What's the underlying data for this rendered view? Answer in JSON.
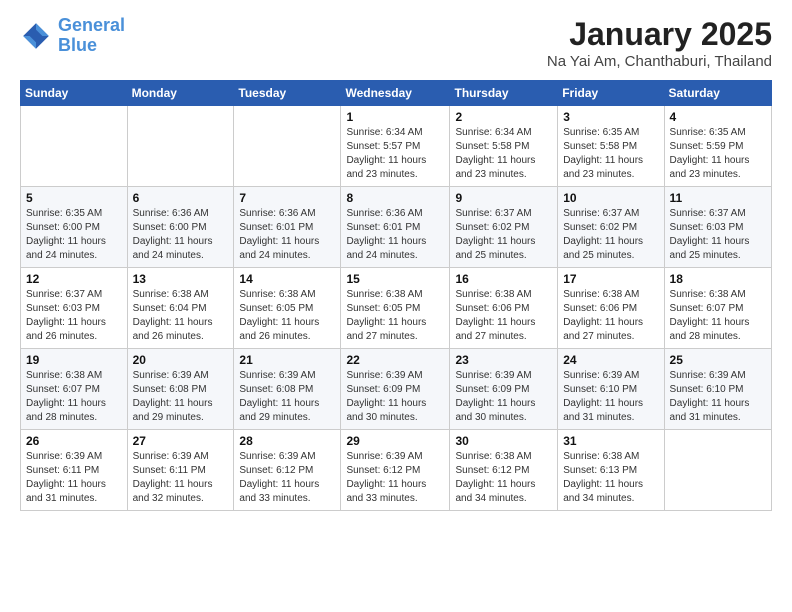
{
  "logo": {
    "line1": "General",
    "line2": "Blue"
  },
  "title": "January 2025",
  "subtitle": "Na Yai Am, Chanthaburi, Thailand",
  "days_of_week": [
    "Sunday",
    "Monday",
    "Tuesday",
    "Wednesday",
    "Thursday",
    "Friday",
    "Saturday"
  ],
  "weeks": [
    [
      {
        "day": "",
        "info": ""
      },
      {
        "day": "",
        "info": ""
      },
      {
        "day": "",
        "info": ""
      },
      {
        "day": "1",
        "info": "Sunrise: 6:34 AM\nSunset: 5:57 PM\nDaylight: 11 hours\nand 23 minutes."
      },
      {
        "day": "2",
        "info": "Sunrise: 6:34 AM\nSunset: 5:58 PM\nDaylight: 11 hours\nand 23 minutes."
      },
      {
        "day": "3",
        "info": "Sunrise: 6:35 AM\nSunset: 5:58 PM\nDaylight: 11 hours\nand 23 minutes."
      },
      {
        "day": "4",
        "info": "Sunrise: 6:35 AM\nSunset: 5:59 PM\nDaylight: 11 hours\nand 23 minutes."
      }
    ],
    [
      {
        "day": "5",
        "info": "Sunrise: 6:35 AM\nSunset: 6:00 PM\nDaylight: 11 hours\nand 24 minutes."
      },
      {
        "day": "6",
        "info": "Sunrise: 6:36 AM\nSunset: 6:00 PM\nDaylight: 11 hours\nand 24 minutes."
      },
      {
        "day": "7",
        "info": "Sunrise: 6:36 AM\nSunset: 6:01 PM\nDaylight: 11 hours\nand 24 minutes."
      },
      {
        "day": "8",
        "info": "Sunrise: 6:36 AM\nSunset: 6:01 PM\nDaylight: 11 hours\nand 24 minutes."
      },
      {
        "day": "9",
        "info": "Sunrise: 6:37 AM\nSunset: 6:02 PM\nDaylight: 11 hours\nand 25 minutes."
      },
      {
        "day": "10",
        "info": "Sunrise: 6:37 AM\nSunset: 6:02 PM\nDaylight: 11 hours\nand 25 minutes."
      },
      {
        "day": "11",
        "info": "Sunrise: 6:37 AM\nSunset: 6:03 PM\nDaylight: 11 hours\nand 25 minutes."
      }
    ],
    [
      {
        "day": "12",
        "info": "Sunrise: 6:37 AM\nSunset: 6:03 PM\nDaylight: 11 hours\nand 26 minutes."
      },
      {
        "day": "13",
        "info": "Sunrise: 6:38 AM\nSunset: 6:04 PM\nDaylight: 11 hours\nand 26 minutes."
      },
      {
        "day": "14",
        "info": "Sunrise: 6:38 AM\nSunset: 6:05 PM\nDaylight: 11 hours\nand 26 minutes."
      },
      {
        "day": "15",
        "info": "Sunrise: 6:38 AM\nSunset: 6:05 PM\nDaylight: 11 hours\nand 27 minutes."
      },
      {
        "day": "16",
        "info": "Sunrise: 6:38 AM\nSunset: 6:06 PM\nDaylight: 11 hours\nand 27 minutes."
      },
      {
        "day": "17",
        "info": "Sunrise: 6:38 AM\nSunset: 6:06 PM\nDaylight: 11 hours\nand 27 minutes."
      },
      {
        "day": "18",
        "info": "Sunrise: 6:38 AM\nSunset: 6:07 PM\nDaylight: 11 hours\nand 28 minutes."
      }
    ],
    [
      {
        "day": "19",
        "info": "Sunrise: 6:38 AM\nSunset: 6:07 PM\nDaylight: 11 hours\nand 28 minutes."
      },
      {
        "day": "20",
        "info": "Sunrise: 6:39 AM\nSunset: 6:08 PM\nDaylight: 11 hours\nand 29 minutes."
      },
      {
        "day": "21",
        "info": "Sunrise: 6:39 AM\nSunset: 6:08 PM\nDaylight: 11 hours\nand 29 minutes."
      },
      {
        "day": "22",
        "info": "Sunrise: 6:39 AM\nSunset: 6:09 PM\nDaylight: 11 hours\nand 30 minutes."
      },
      {
        "day": "23",
        "info": "Sunrise: 6:39 AM\nSunset: 6:09 PM\nDaylight: 11 hours\nand 30 minutes."
      },
      {
        "day": "24",
        "info": "Sunrise: 6:39 AM\nSunset: 6:10 PM\nDaylight: 11 hours\nand 31 minutes."
      },
      {
        "day": "25",
        "info": "Sunrise: 6:39 AM\nSunset: 6:10 PM\nDaylight: 11 hours\nand 31 minutes."
      }
    ],
    [
      {
        "day": "26",
        "info": "Sunrise: 6:39 AM\nSunset: 6:11 PM\nDaylight: 11 hours\nand 31 minutes."
      },
      {
        "day": "27",
        "info": "Sunrise: 6:39 AM\nSunset: 6:11 PM\nDaylight: 11 hours\nand 32 minutes."
      },
      {
        "day": "28",
        "info": "Sunrise: 6:39 AM\nSunset: 6:12 PM\nDaylight: 11 hours\nand 33 minutes."
      },
      {
        "day": "29",
        "info": "Sunrise: 6:39 AM\nSunset: 6:12 PM\nDaylight: 11 hours\nand 33 minutes."
      },
      {
        "day": "30",
        "info": "Sunrise: 6:38 AM\nSunset: 6:12 PM\nDaylight: 11 hours\nand 34 minutes."
      },
      {
        "day": "31",
        "info": "Sunrise: 6:38 AM\nSunset: 6:13 PM\nDaylight: 11 hours\nand 34 minutes."
      },
      {
        "day": "",
        "info": ""
      }
    ]
  ]
}
